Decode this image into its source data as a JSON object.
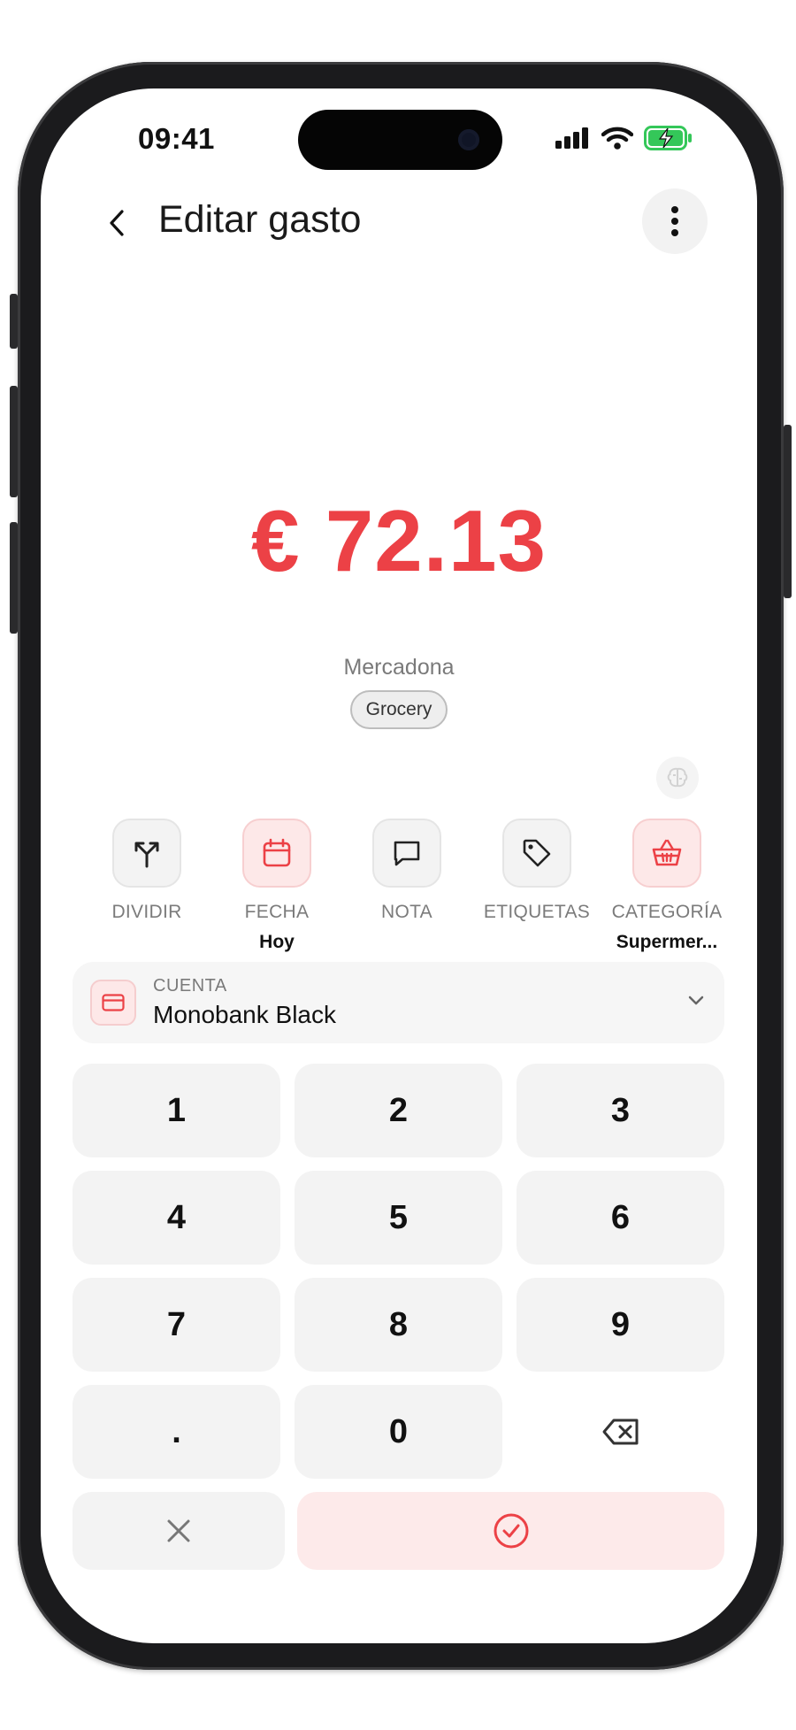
{
  "status": {
    "time": "09:41"
  },
  "header": {
    "title": "Editar gasto"
  },
  "amount": {
    "display": "€ 72.13"
  },
  "merchant": "Mercadona",
  "tag": "Grocery",
  "actions": [
    {
      "label": "DIVIDIR",
      "value": "",
      "icon": "split-icon"
    },
    {
      "label": "FECHA",
      "value": "Hoy",
      "icon": "calendar-icon"
    },
    {
      "label": "NOTA",
      "value": "",
      "icon": "note-icon"
    },
    {
      "label": "ETIQUETAS",
      "value": "",
      "icon": "tag-icon"
    },
    {
      "label": "CATEGORÍA",
      "value": "Supermer...",
      "icon": "basket-icon"
    }
  ],
  "account": {
    "label": "CUENTA",
    "value": "Monobank Black"
  },
  "keypad": {
    "keys": [
      "1",
      "2",
      "3",
      "4",
      "5",
      "6",
      "7",
      "8",
      "9",
      ".",
      "0"
    ]
  },
  "colors": {
    "accent": "#ec4146",
    "accent_soft": "#fde8e8",
    "key_bg": "#f3f3f3"
  }
}
